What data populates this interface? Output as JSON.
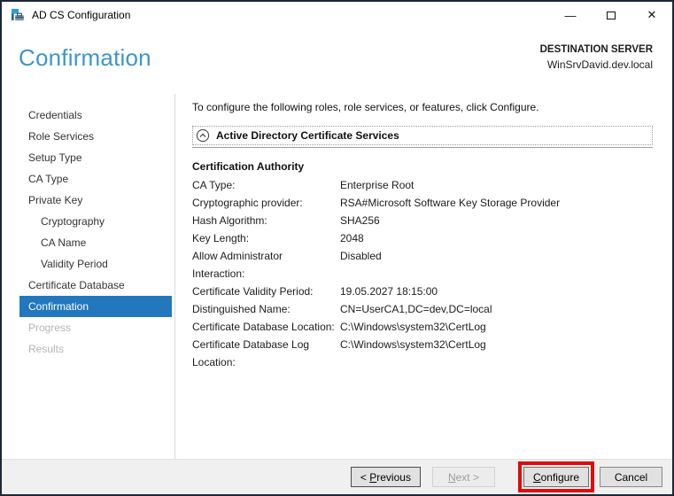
{
  "window": {
    "title": "AD CS Configuration",
    "controls": {
      "minimize_glyph": "—",
      "close_glyph": "✕"
    }
  },
  "header": {
    "page_title": "Confirmation",
    "destination_label": "DESTINATION SERVER",
    "destination_server": "WinSrvDavid.dev.local"
  },
  "sidebar": {
    "items": [
      {
        "label": "Credentials",
        "state": "normal",
        "indent": 0
      },
      {
        "label": "Role Services",
        "state": "normal",
        "indent": 0
      },
      {
        "label": "Setup Type",
        "state": "normal",
        "indent": 0
      },
      {
        "label": "CA Type",
        "state": "normal",
        "indent": 0
      },
      {
        "label": "Private Key",
        "state": "normal",
        "indent": 0
      },
      {
        "label": "Cryptography",
        "state": "normal",
        "indent": 1
      },
      {
        "label": "CA Name",
        "state": "normal",
        "indent": 1
      },
      {
        "label": "Validity Period",
        "state": "normal",
        "indent": 1
      },
      {
        "label": "Certificate Database",
        "state": "normal",
        "indent": 0
      },
      {
        "label": "Confirmation",
        "state": "selected",
        "indent": 0
      },
      {
        "label": "Progress",
        "state": "disabled",
        "indent": 0
      },
      {
        "label": "Results",
        "state": "disabled",
        "indent": 0
      }
    ]
  },
  "content": {
    "intro": "To configure the following roles, role services, or features, click Configure.",
    "expander_title": "Active Directory Certificate Services",
    "section_title": "Certification Authority",
    "details": [
      {
        "label": "CA Type:",
        "value": "Enterprise Root"
      },
      {
        "label": "Cryptographic provider:",
        "value": "RSA#Microsoft Software Key Storage Provider"
      },
      {
        "label": "Hash Algorithm:",
        "value": "SHA256"
      },
      {
        "label": "Key Length:",
        "value": "2048"
      },
      {
        "label": "Allow Administrator Interaction:",
        "value": "Disabled"
      },
      {
        "label": "Certificate Validity Period:",
        "value": "19.05.2027 18:15:00"
      },
      {
        "label": "Distinguished Name:",
        "value": "CN=UserCA1,DC=dev,DC=local"
      },
      {
        "label": "Certificate Database Location:",
        "value": "C:\\Windows\\system32\\CertLog"
      },
      {
        "label": "Certificate Database Log Location:",
        "value": "C:\\Windows\\system32\\CertLog"
      }
    ]
  },
  "footer": {
    "buttons": [
      {
        "id": "previous",
        "label": "< Previous",
        "underline_char": "P",
        "enabled": true,
        "annotated": false
      },
      {
        "id": "next",
        "label": "Next >",
        "underline_char": "N",
        "enabled": false,
        "annotated": false
      },
      {
        "id": "configure",
        "label": "Configure",
        "underline_char": "C",
        "enabled": true,
        "annotated": true
      },
      {
        "id": "cancel",
        "label": "Cancel",
        "underline_char": "",
        "enabled": true,
        "annotated": false
      }
    ]
  },
  "colors": {
    "heading_blue": "#3e95c8",
    "selection_blue": "#2277bd",
    "annotation_red": "#e00b0b",
    "window_border": "#1b2838"
  }
}
